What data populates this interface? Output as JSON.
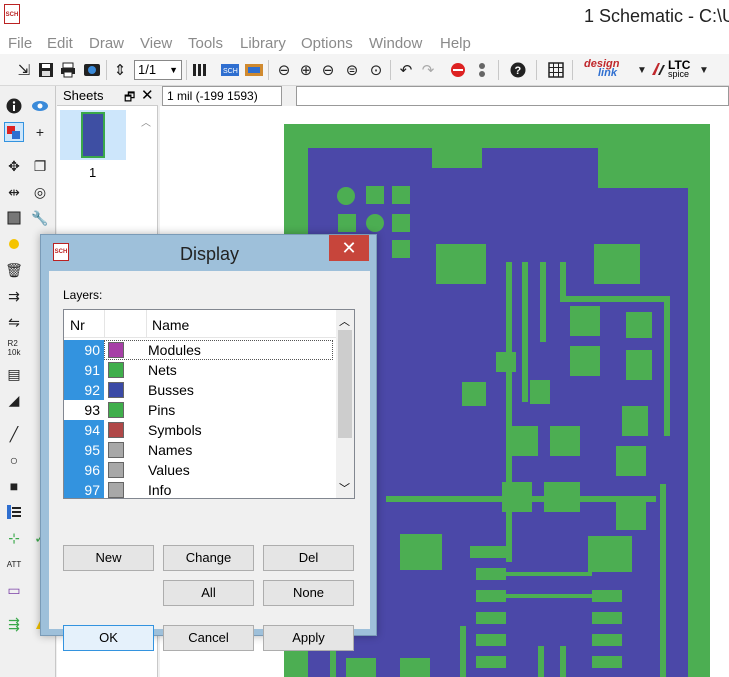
{
  "window": {
    "title": "1 Schematic - C:\\U"
  },
  "menu": [
    "File",
    "Edit",
    "Draw",
    "View",
    "Tools",
    "Library",
    "Options",
    "Window",
    "Help"
  ],
  "toolbar": {
    "sheet_select": "1/1",
    "designlink_line1": "design",
    "designlink_line2": "link",
    "ltc_label": "LTC",
    "spice_label": "spice"
  },
  "sheets": {
    "title": "Sheets",
    "pin_glyph": "🗗",
    "close_glyph": "✕",
    "sheet_number": "1"
  },
  "coords": {
    "display": "1 mil (-199 1593)",
    "command_value": ""
  },
  "dialog": {
    "title": "Display",
    "close_glyph": "✕",
    "layers_label": "Layers:",
    "columns": {
      "nr": "Nr",
      "name": "Name"
    },
    "layers": [
      {
        "nr": "90",
        "name": "Modules",
        "color": "#a63fa6",
        "selected": true,
        "focus": true
      },
      {
        "nr": "91",
        "name": "Nets",
        "color": "#3fae4b",
        "selected": true,
        "focus": false
      },
      {
        "nr": "92",
        "name": "Busses",
        "color": "#3b4aa6",
        "selected": true,
        "focus": false
      },
      {
        "nr": "93",
        "name": "Pins",
        "color": "#3fae4b",
        "selected": false,
        "focus": false
      },
      {
        "nr": "94",
        "name": "Symbols",
        "color": "#b04848",
        "selected": true,
        "focus": false
      },
      {
        "nr": "95",
        "name": "Names",
        "color": "#a8a8a8",
        "selected": true,
        "focus": false
      },
      {
        "nr": "96",
        "name": "Values",
        "color": "#a8a8a8",
        "selected": true,
        "focus": false
      },
      {
        "nr": "97",
        "name": "Info",
        "color": "#a8a8a8",
        "selected": true,
        "focus": false
      }
    ],
    "buttons": {
      "new": "New",
      "change": "Change",
      "del": "Del",
      "all": "All",
      "none": "None",
      "ok": "OK",
      "cancel": "Cancel",
      "apply": "Apply"
    }
  },
  "colors": {
    "board_green": "#4cae52",
    "board_blue": "#4b48a8",
    "selection_blue": "#3393df"
  }
}
